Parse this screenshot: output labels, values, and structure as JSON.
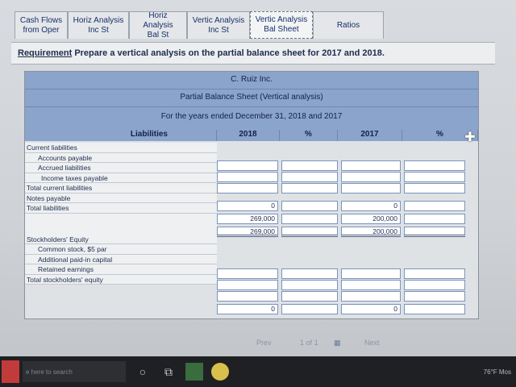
{
  "tabs": [
    {
      "l1": "Cash Flows",
      "l2": "from Oper"
    },
    {
      "l1": "Horiz Analysis",
      "l2": "Inc St"
    },
    {
      "l1": "Horiz Analysis",
      "l2": "Bal St"
    },
    {
      "l1": "Vertic Analysis",
      "l2": "Inc St"
    },
    {
      "l1": "Vertic Analysis",
      "l2": "Bal Sheet"
    },
    {
      "l1": "Ratios",
      "l2": ""
    }
  ],
  "requirement": {
    "lead": "Requirement",
    "text": "Prepare a vertical analysis on the partial balance sheet for 2017 and 2018."
  },
  "sheet": {
    "company": "C. Ruiz Inc.",
    "title": "Partial Balance Sheet (Vertical analysis)",
    "period": "For the years ended December 31, 2018 and 2017",
    "col_label": "Liabilities",
    "col_2018": "2018",
    "col_pct1": "%",
    "col_2017": "2017",
    "col_pct2": "%"
  },
  "rows": [
    "Current liabilities",
    "Accounts payable",
    "Accrued liabilities",
    "Income taxes payable",
    "Total current liabilities",
    "Notes payable",
    "Total liabilities",
    "Stockholders' Equity",
    "Common stock, $5 par",
    "Additional paid-in capital",
    "Retained earnings",
    "Total stockholders' equity"
  ],
  "values": {
    "tcl_2018": "0",
    "tcl_2017": "0",
    "np_2018": "269,000",
    "np_2017": "200,000",
    "tl_2018": "269,000",
    "tl_2017": "200,000",
    "tse_2018": "0",
    "tse_2017": "0"
  },
  "pager": {
    "prev": "Prev",
    "page": "1",
    "of": "of",
    "total": "1",
    "next": "Next"
  },
  "taskbar": {
    "search_placeholder": "e here to search",
    "weather": "76°F Mos"
  }
}
